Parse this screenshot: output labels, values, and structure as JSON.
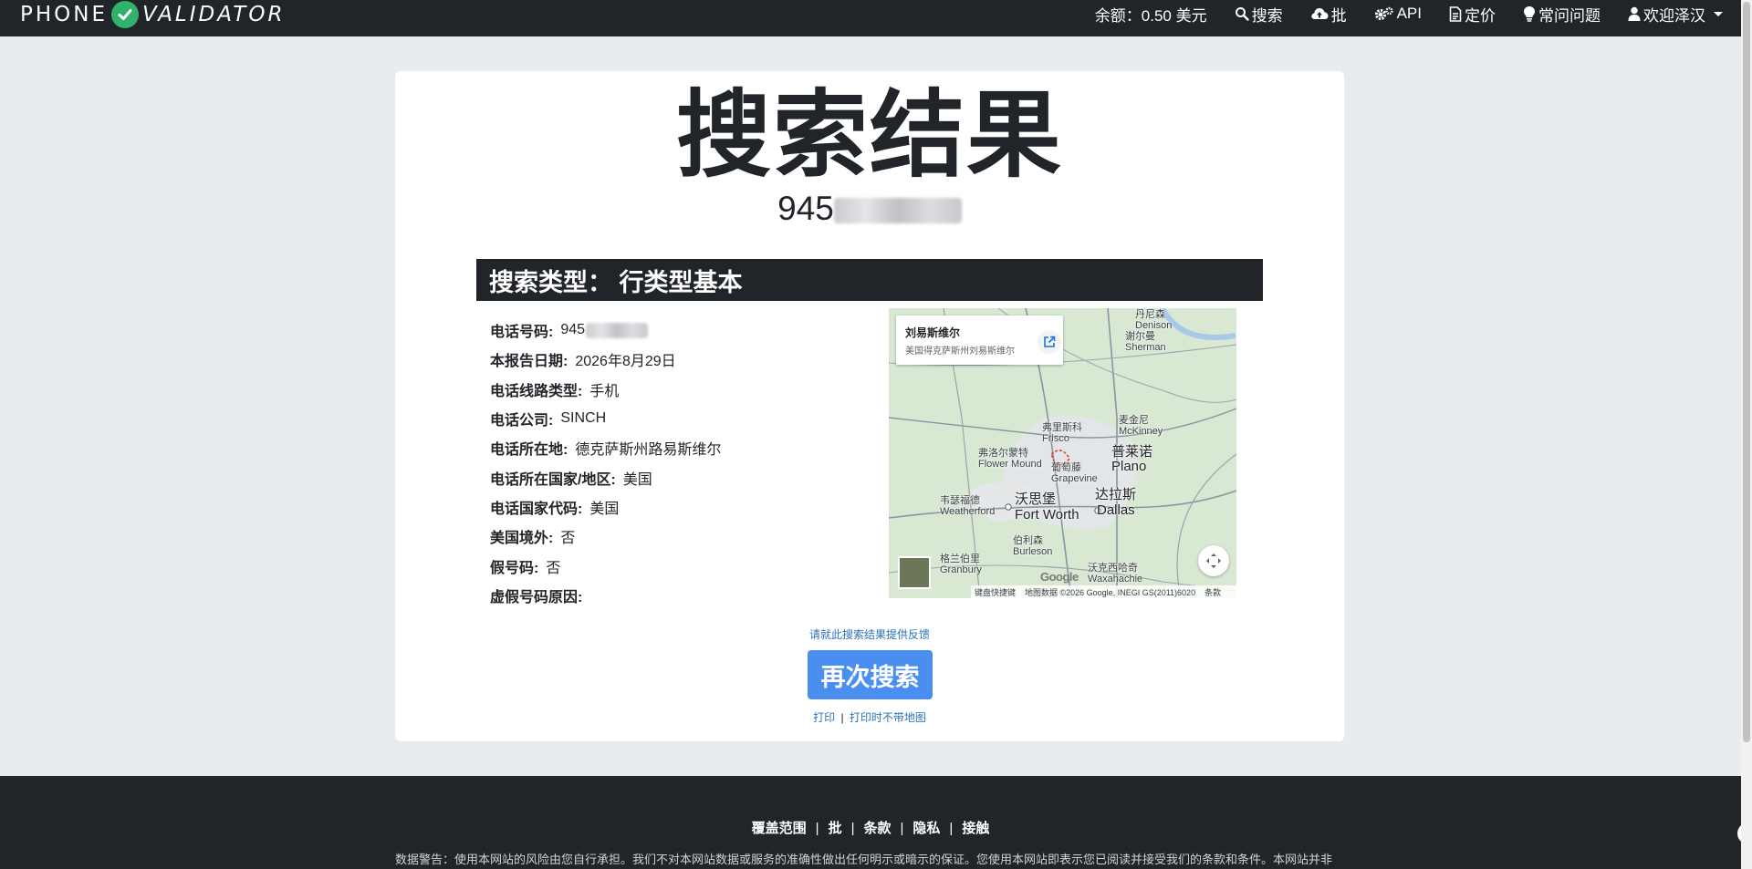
{
  "nav": {
    "brand_part1": "PHONE",
    "brand_part2": "VALIDATOR",
    "balance": "余额：0.50 美元",
    "search": "搜索",
    "bulk": "批",
    "api": "API",
    "pricing": "定价",
    "faq": "常问问题",
    "welcome": "欢迎泽汉"
  },
  "result": {
    "title": "搜索结果",
    "phone_visible": "945",
    "section_title": "搜索类型： 行类型基本",
    "fields": [
      {
        "label": "电话号码:",
        "value": "945"
      },
      {
        "label": "本报告日期:",
        "value": "2026年8月29日"
      },
      {
        "label": "电话线路类型:",
        "value": "手机"
      },
      {
        "label": "电话公司:",
        "value": "SINCH"
      },
      {
        "label": "电话所在地:",
        "value": "德克萨斯州路易斯维尔"
      },
      {
        "label": "电话所在国家/地区:",
        "value": "美国"
      },
      {
        "label": "电话国家代码:",
        "value": "美国"
      },
      {
        "label": "美国境外:",
        "value": "否"
      },
      {
        "label": "假号码:",
        "value": "否"
      },
      {
        "label": "虚假号码原因:",
        "value": ""
      }
    ],
    "feedback_link": "请就此搜索结果提供反馈",
    "search_again": "再次搜索",
    "print": "打印",
    "print_separator": "|",
    "print_no_map": "打印时不带地图"
  },
  "map": {
    "place_title": "刘易斯维尔",
    "place_subtitle": "美国得克萨斯州刘易斯维尔",
    "labels": {
      "denison": "丹尼森\nDenison",
      "sherman": "谢尔曼\nSherman",
      "mckinney": "麦金尼\nMcKinney",
      "frisco": "弗里斯科\nFrisco",
      "plano": "普莱诺\nPlano",
      "flower_mound": "弗洛尔蒙特\nFlower Mound",
      "grapevine": "葡萄藤\nGrapevine",
      "weatherford": "韦瑟福德\nWeatherford",
      "fort_worth_cn": "沃思堡",
      "fort_worth": "Fort Worth",
      "dallas_cn": "达拉斯",
      "dallas": "Dallas",
      "burleson": "伯利森\nBurleson",
      "granbury": "格兰伯里\nGranbury",
      "waxahachie": "沃克西哈奇\nWaxahachie"
    },
    "shortcuts": "键盘快捷键",
    "attribution": "地图数据 ©2026 Google, INEGI GS(2011)6020",
    "terms": "条款",
    "google": "Google"
  },
  "footer": {
    "links": [
      "覆盖范围",
      "批",
      "条款",
      "隐私",
      "接触"
    ],
    "separator": "|",
    "warning": "数据警告：使用本网站的风险由您自行承担。我们不对本网站数据或服务的准确性做出任何明示或暗示的保证。您使用本网站即表示您已阅读并接受我们的条款和条件。本网站并非"
  },
  "colors": {
    "navbar": "#212529",
    "brand_check": "#2fb36b",
    "button": "#4a8ef0",
    "link": "#2a72b5",
    "page_bg": "#e9ecef"
  }
}
